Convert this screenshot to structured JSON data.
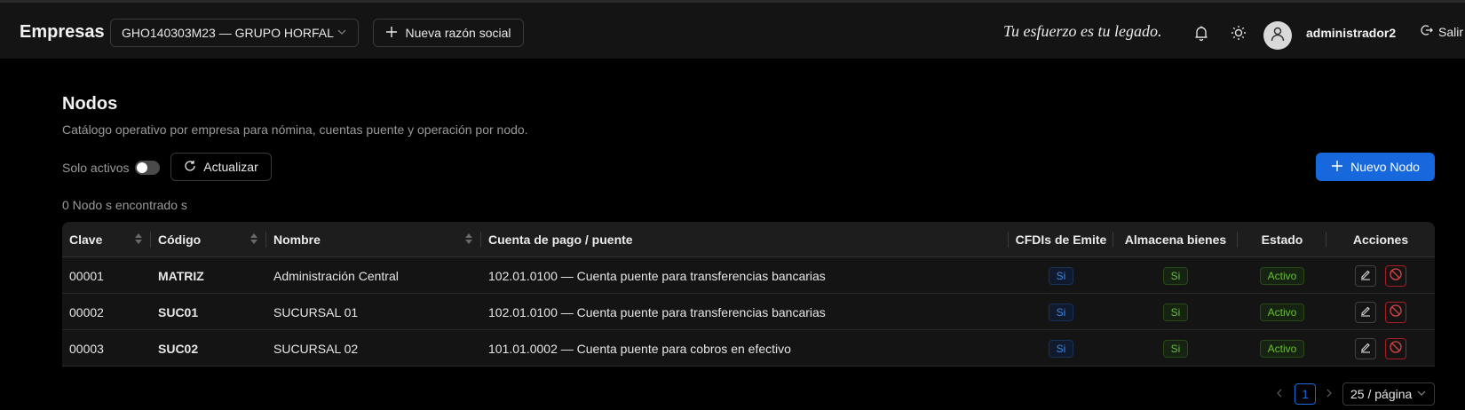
{
  "header": {
    "brand": "Empresas",
    "company_select": "GHO140303M23 — GRUPO HORFAL",
    "new_company_label": "Nueva razón social",
    "slogan": "Tu esfuerzo es tu legado.",
    "username": "administrador2",
    "logout_label": "Salir"
  },
  "page": {
    "title": "Nodos",
    "subtitle": "Catálogo operativo por empresa para nómina, cuentas puente y operación por nodo.",
    "solo_activos_label": "Solo activos",
    "refresh_label": "Actualizar",
    "new_node_label": "Nuevo Nodo",
    "count_text": "0 Nodo s encontrado s"
  },
  "table": {
    "columns": [
      "Clave",
      "Código",
      "Nombre",
      "Cuenta de pago / puente",
      "CFDIs de Emite",
      "Almacena bienes",
      "Estado",
      "Acciones"
    ],
    "rows": [
      {
        "clave": "00001",
        "codigo": "MATRIZ",
        "nombre": "Administración Central",
        "cuenta": "102.01.0100 — Cuenta puente para transferencias bancarias",
        "cfdi": "Si",
        "almacena": "Si",
        "estado": "Activo"
      },
      {
        "clave": "00002",
        "codigo": "SUC01",
        "nombre": "SUCURSAL 01",
        "cuenta": "102.01.0100 — Cuenta puente para transferencias bancarias",
        "cfdi": "Si",
        "almacena": "Si",
        "estado": "Activo"
      },
      {
        "clave": "00003",
        "codigo": "SUC02",
        "nombre": "SUCURSAL 02",
        "cuenta": "101.01.0002 — Cuenta puente para cobros en efectivo",
        "cfdi": "Si",
        "almacena": "Si",
        "estado": "Activo"
      }
    ]
  },
  "pagination": {
    "current_page": "1",
    "page_size": "25 / página"
  },
  "icons": {
    "new_company": "plus-icon",
    "notifications": "bell-icon",
    "theme": "sun-icon",
    "user": "user-icon",
    "logout": "logout-icon",
    "refresh": "reload-icon",
    "new_node": "plus-icon",
    "edit": "edit-icon",
    "delete": "stop-icon"
  },
  "colors": {
    "primary": "#1668dc",
    "danger": "#dc4446",
    "success": "#6abe39",
    "info": "#3c89e8"
  }
}
